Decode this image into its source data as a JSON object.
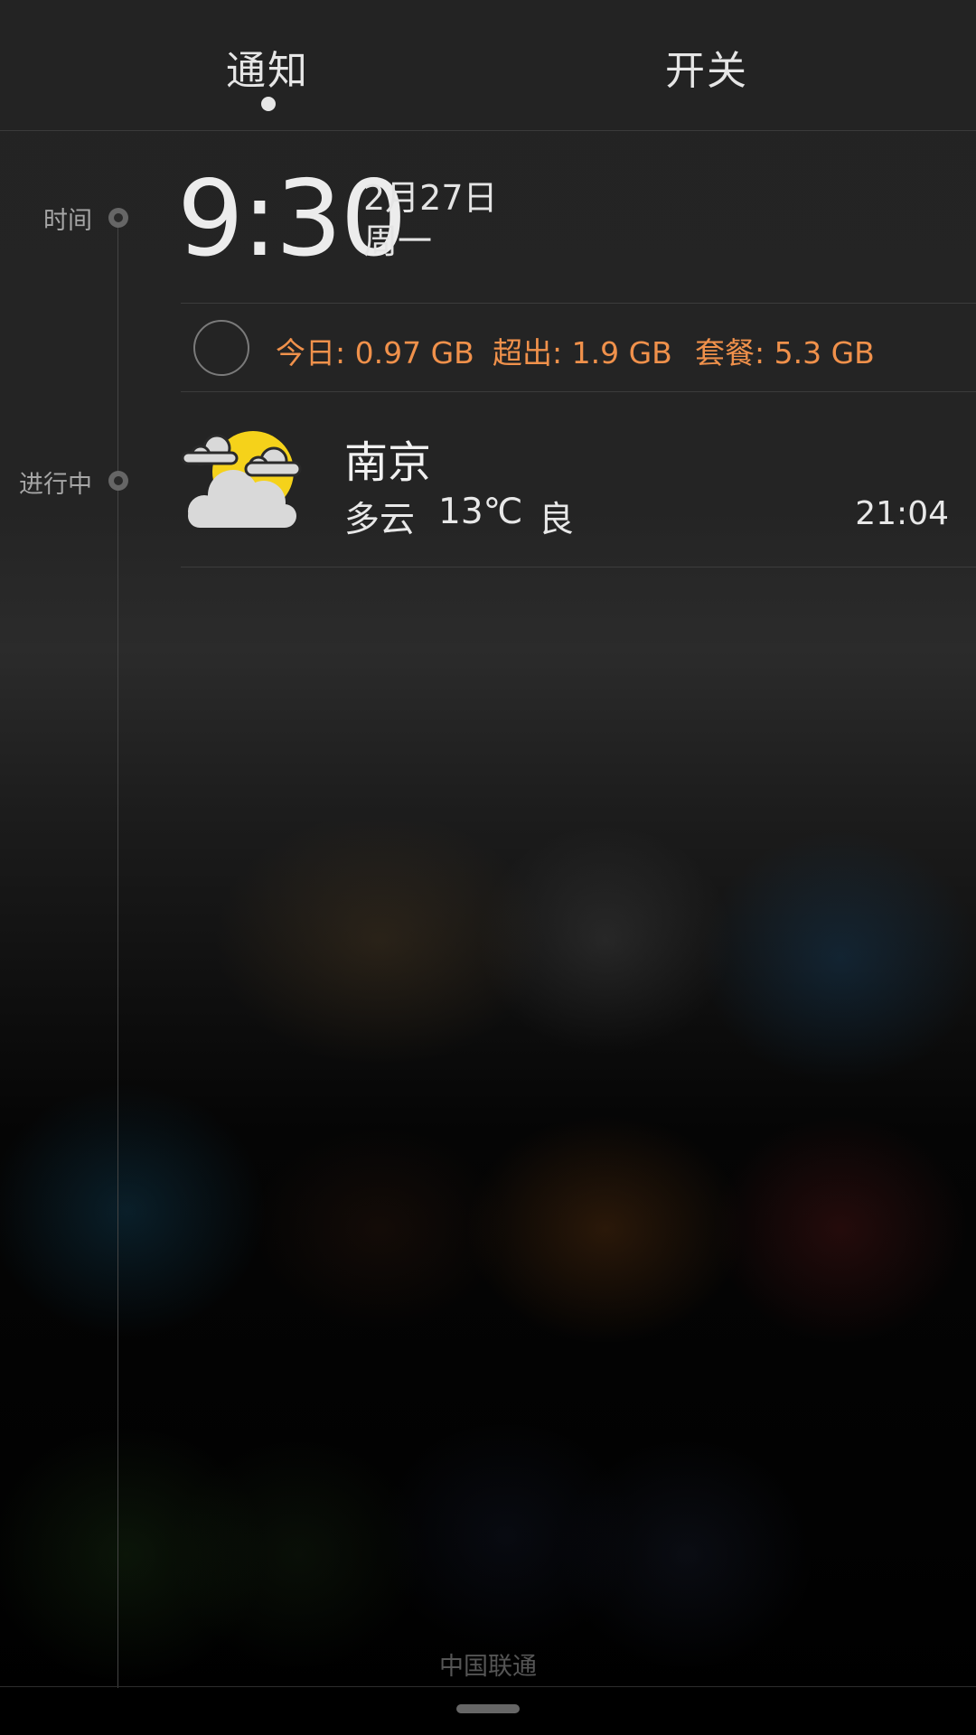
{
  "tabs": [
    {
      "label": "通知",
      "active": true
    },
    {
      "label": "开关",
      "active": false
    }
  ],
  "timeline": {
    "time_label": "时间",
    "progress_label": "进行中"
  },
  "clock": {
    "time": "9:30",
    "date": "2月27日",
    "weekday": "周一"
  },
  "data_usage": {
    "today": "今日: 0.97 GB",
    "over": "超出: 1.9 GB",
    "plan": "套餐: 5.3 GB"
  },
  "weather": {
    "icon": "partly-cloudy-icon",
    "city": "南京",
    "condition": "多云",
    "temperature": "13℃",
    "air_quality": "良",
    "update_time": "21:04"
  },
  "carrier": "中国联通",
  "colors": {
    "accent": "#f0914b",
    "sun": "#f5d21a",
    "cloud": "#d9d9d9"
  }
}
